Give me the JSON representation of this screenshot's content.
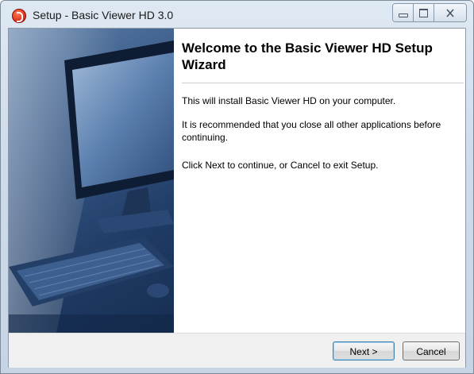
{
  "window": {
    "title": "Setup - Basic Viewer HD 3.0",
    "icon": "app-logo-icon",
    "controls": [
      "minimize-icon",
      "maximize-icon",
      "close-icon"
    ]
  },
  "wizard": {
    "heading": "Welcome to the Basic Viewer HD Setup Wizard",
    "paragraphs": [
      "This will install Basic Viewer HD on your computer.",
      "It is recommended that you close all other applications before continuing.",
      "Click Next to continue, or Cancel to exit Setup."
    ],
    "side_image": "computer-monitor-keyboard-illustration"
  },
  "buttons": {
    "next_label": "Next >",
    "cancel_label": "Cancel"
  },
  "colors": {
    "title_bar": "#cfdceb",
    "side_panel": "#2a4a76",
    "footer": "#f0f0f0"
  }
}
